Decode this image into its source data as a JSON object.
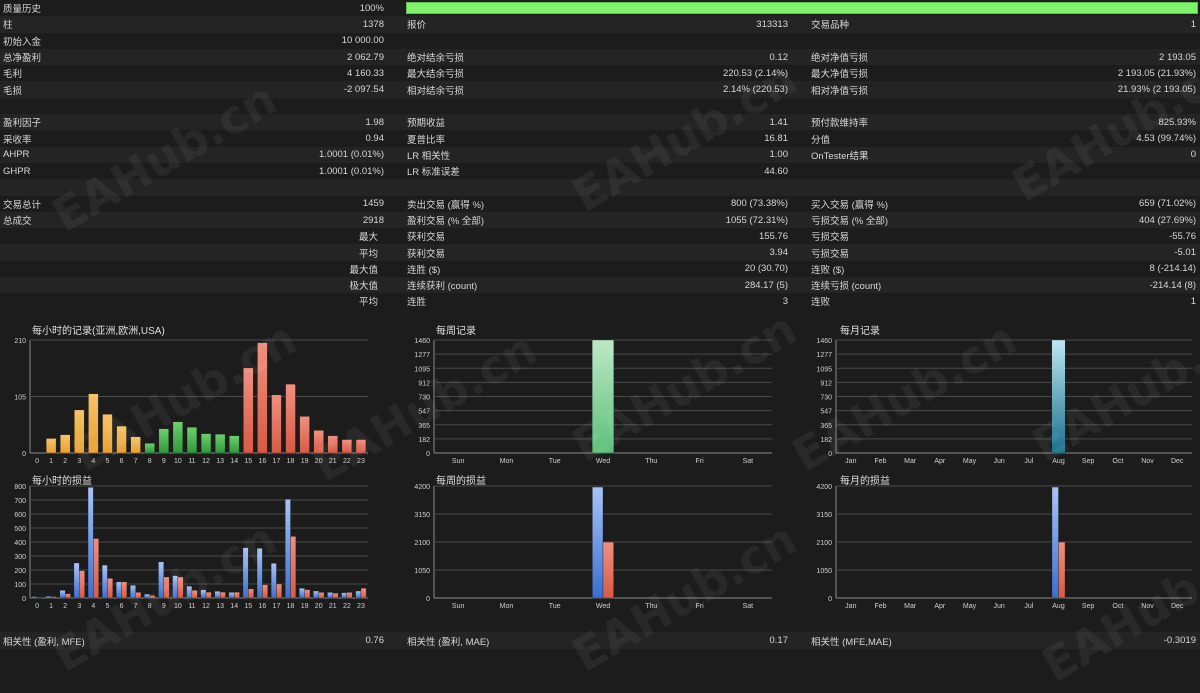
{
  "quality": {
    "label": "质量历史",
    "value": "100%",
    "fill": 1.0
  },
  "rows": [
    [
      [
        "柱",
        "1378"
      ],
      [
        "报价",
        "313313"
      ],
      [
        "交易品种",
        "1"
      ]
    ],
    [
      [
        "初始入金",
        "10 000.00"
      ],
      [
        "",
        ""
      ],
      [
        "",
        ""
      ]
    ],
    [
      [
        "总净盈利",
        "2 062.79"
      ],
      [
        "绝对结余亏损",
        "0.12"
      ],
      [
        "绝对净值亏损",
        "2 193.05"
      ]
    ],
    [
      [
        "毛利",
        "4 160.33"
      ],
      [
        "最大结余亏损",
        "220.53 (2.14%)"
      ],
      [
        "最大净值亏损",
        "2 193.05 (21.93%)"
      ]
    ],
    [
      [
        "毛损",
        "-2 097.54"
      ],
      [
        "相对结余亏损",
        "2.14% (220.53)"
      ],
      [
        "相对净值亏损",
        "21.93% (2 193.05)"
      ]
    ],
    [
      [
        "",
        ""
      ],
      [
        "",
        ""
      ],
      [
        "",
        ""
      ]
    ],
    [
      [
        "盈利因子",
        "1.98"
      ],
      [
        "预期收益",
        "1.41"
      ],
      [
        "预付款维持率",
        "825.93%"
      ]
    ],
    [
      [
        "采收率",
        "0.94"
      ],
      [
        "夏普比率",
        "16.81"
      ],
      [
        "分值",
        "4.53 (99.74%)"
      ]
    ],
    [
      [
        "AHPR",
        "1.0001 (0.01%)"
      ],
      [
        "LR 相关性",
        "1.00"
      ],
      [
        "OnTester结果",
        "0"
      ]
    ],
    [
      [
        "GHPR",
        "1.0001 (0.01%)"
      ],
      [
        "LR 标准误差",
        "44.60"
      ],
      [
        "",
        ""
      ]
    ],
    [
      [
        "",
        ""
      ],
      [
        "",
        ""
      ],
      [
        "",
        ""
      ]
    ],
    [
      [
        "交易总计",
        "1459"
      ],
      [
        "卖出交易 (赢得 %)",
        "800 (73.38%)"
      ],
      [
        "买入交易 (赢得 %)",
        "659 (71.02%)"
      ]
    ],
    [
      [
        "总成交",
        "2918"
      ],
      [
        "盈利交易 (% 全部)",
        "1055 (72.31%)"
      ],
      [
        "亏损交易 (% 全部)",
        "404 (27.69%)"
      ]
    ],
    [
      [
        "最大",
        "",
        "right"
      ],
      [
        "获利交易",
        "155.76"
      ],
      [
        "亏损交易",
        "-55.76"
      ]
    ],
    [
      [
        "平均",
        "",
        "right"
      ],
      [
        "获利交易",
        "3.94"
      ],
      [
        "亏损交易",
        "-5.01"
      ]
    ],
    [
      [
        "最大值",
        "",
        "right"
      ],
      [
        "连胜 ($)",
        "20 (30.70)"
      ],
      [
        "连败 ($)",
        "8 (-214.14)"
      ]
    ],
    [
      [
        "极大值",
        "",
        "right"
      ],
      [
        "连续获利 (count)",
        "284.17 (5)"
      ],
      [
        "连续亏损 (count)",
        "-214.14 (8)"
      ]
    ],
    [
      [
        "平均",
        "",
        "right"
      ],
      [
        "连胜",
        "3"
      ],
      [
        "连败",
        "1"
      ]
    ]
  ],
  "colors": {
    "orange": "#e8a030",
    "green": "#2e9a3a",
    "red": "#d85a44",
    "blue": "#3a6fd0",
    "wed": "#5cc07a",
    "aug": "#3aa6c4"
  },
  "chart_data": [
    {
      "type": "bar",
      "title": "每小时的记录(亚洲,欧洲,USA)",
      "categories": [
        "0",
        "1",
        "2",
        "3",
        "4",
        "5",
        "6",
        "7",
        "8",
        "9",
        "10",
        "11",
        "12",
        "13",
        "14",
        "15",
        "16",
        "17",
        "18",
        "19",
        "20",
        "21",
        "22",
        "23"
      ],
      "values": [
        0,
        27,
        34,
        80,
        110,
        72,
        50,
        30,
        18,
        45,
        58,
        48,
        36,
        35,
        32,
        158,
        205,
        108,
        128,
        68,
        42,
        32,
        25,
        25
      ],
      "yticks": [
        "0",
        "105",
        "210"
      ],
      "ymax": 210
    },
    {
      "type": "bar",
      "title": "每周记录",
      "categories": [
        "Sun",
        "Mon",
        "Tue",
        "Wed",
        "Thu",
        "Fri",
        "Sat"
      ],
      "values": [
        0,
        0,
        0,
        1460,
        0,
        0,
        0
      ],
      "yticks": [
        "0",
        "182",
        "365",
        "547",
        "730",
        "912",
        "1095",
        "1277",
        "1460"
      ],
      "ymax": 1460
    },
    {
      "type": "bar",
      "title": "每月记录",
      "categories": [
        "Jan",
        "Feb",
        "Mar",
        "Apr",
        "May",
        "Jun",
        "Jul",
        "Aug",
        "Sep",
        "Oct",
        "Nov",
        "Dec"
      ],
      "values": [
        0,
        0,
        0,
        0,
        0,
        0,
        0,
        1460,
        0,
        0,
        0,
        0
      ],
      "yticks": [
        "0",
        "182",
        "365",
        "547",
        "730",
        "912",
        "1095",
        "1277",
        "1460"
      ],
      "ymax": 1460
    },
    {
      "type": "bar",
      "title": "每小时的损益",
      "categories": [
        "0",
        "1",
        "2",
        "3",
        "4",
        "5",
        "6",
        "7",
        "8",
        "9",
        "10",
        "11",
        "12",
        "13",
        "14",
        "15",
        "16",
        "17",
        "18",
        "19",
        "20",
        "21",
        "22",
        "23"
      ],
      "series": [
        {
          "values": [
            10,
            12,
            55,
            250,
            790,
            235,
            115,
            90,
            28,
            258,
            160,
            85,
            58,
            48,
            40,
            360,
            355,
            248,
            705,
            70,
            50,
            40,
            38,
            50
          ]
        },
        {
          "values": [
            5,
            10,
            30,
            195,
            425,
            140,
            115,
            40,
            18,
            150,
            150,
            55,
            42,
            42,
            42,
            65,
            95,
            100,
            440,
            60,
            40,
            35,
            40,
            70
          ]
        }
      ],
      "yticks": [
        "0",
        "100",
        "200",
        "300",
        "400",
        "500",
        "600",
        "700",
        "800"
      ],
      "ymax": 800
    },
    {
      "type": "bar",
      "title": "每周的损益",
      "categories": [
        "Sun",
        "Mon",
        "Tue",
        "Wed",
        "Thu",
        "Fri",
        "Sat"
      ],
      "series": [
        {
          "values": [
            0,
            0,
            0,
            4160,
            0,
            0,
            0
          ]
        },
        {
          "values": [
            0,
            0,
            0,
            2098,
            0,
            0,
            0
          ]
        }
      ],
      "yticks": [
        "0",
        "1050",
        "2100",
        "3150",
        "4200"
      ],
      "ymax": 4200
    },
    {
      "type": "bar",
      "title": "每月的损益",
      "categories": [
        "Jan",
        "Feb",
        "Mar",
        "Apr",
        "May",
        "Jun",
        "Jul",
        "Aug",
        "Sep",
        "Oct",
        "Nov",
        "Dec"
      ],
      "series": [
        {
          "values": [
            0,
            0,
            0,
            0,
            0,
            0,
            0,
            4160,
            0,
            0,
            0,
            0
          ]
        },
        {
          "values": [
            0,
            0,
            0,
            0,
            0,
            0,
            0,
            2098,
            0,
            0,
            0,
            0
          ]
        }
      ],
      "yticks": [
        "0",
        "1050",
        "2100",
        "3150",
        "4200"
      ],
      "ymax": 4200
    }
  ],
  "footer": [
    [
      "相关性 (盈利, MFE)",
      "0.76"
    ],
    [
      "相关性 (盈利, MAE)",
      "0.17"
    ],
    [
      "相关性 (MFE,MAE)",
      "-0.3019"
    ]
  ],
  "watermark": "EAHub.cn"
}
